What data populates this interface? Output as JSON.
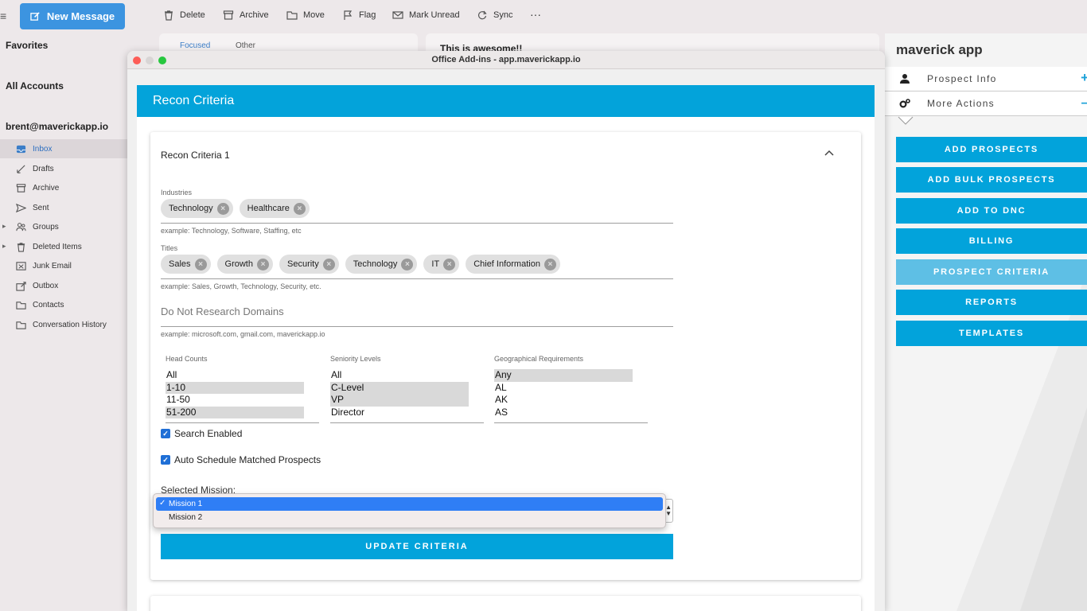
{
  "toolbar": {
    "new_message": "New Message",
    "items": [
      "Delete",
      "Archive",
      "Move",
      "Flag",
      "Mark Unread",
      "Sync",
      "···"
    ]
  },
  "sidebar": {
    "favorites": "Favorites",
    "all_accounts": "All Accounts",
    "account": "brent@maverickapp.io",
    "folders": [
      "Inbox",
      "Drafts",
      "Archive",
      "Sent",
      "Groups",
      "Deleted Items",
      "Junk Email",
      "Outbox",
      "Contacts",
      "Conversation History"
    ]
  },
  "msglist": {
    "tab_focused": "Focused",
    "tab_other": "Other"
  },
  "reading": {
    "subject": "This is awesome!!"
  },
  "window": {
    "title": "Office Add-ins - app.maverickapp.io"
  },
  "form": {
    "header": "Recon Criteria",
    "card_title": "Recon Criteria 1",
    "industries_label": "Industries",
    "industries": [
      "Technology",
      "Healthcare"
    ],
    "industries_hint": "example: Technology, Software, Staffing, etc",
    "titles_label": "Titles",
    "titles": [
      "Sales",
      "Growth",
      "Security",
      "Technology",
      "IT",
      "Chief Information"
    ],
    "titles_hint": "example: Sales, Growth, Technology, Security, etc.",
    "domains_placeholder": "Do Not Research Domains",
    "domains_hint": "example: microsoft.com, gmail.com, maverickapp.io",
    "headcounts_label": "Head Counts",
    "headcounts": [
      "All",
      "1-10",
      "11-50",
      "51-200"
    ],
    "seniority_label": "Seniority Levels",
    "seniority": [
      "All",
      "C-Level",
      "VP",
      "Director"
    ],
    "geo_label": "Geographical Requirements",
    "geo": [
      "Any",
      "AL",
      "AK",
      "AS"
    ],
    "search_enabled": "Search Enabled",
    "auto_schedule": "Auto Schedule Matched Prospects",
    "mission_label": "Selected Mission:",
    "mission_options": [
      "Mission 1",
      "Mission 2"
    ],
    "update_button": "UPDATE CRITERIA"
  },
  "addin": {
    "title": "maverick app",
    "prospect_info": "Prospect Info",
    "more_actions": "More Actions",
    "buttons": [
      "ADD PROSPECTS",
      "ADD BULK PROSPECTS",
      "ADD TO DNC",
      "BILLING",
      "PROSPECT CRITERIA",
      "REPORTS",
      "TEMPLATES"
    ]
  }
}
